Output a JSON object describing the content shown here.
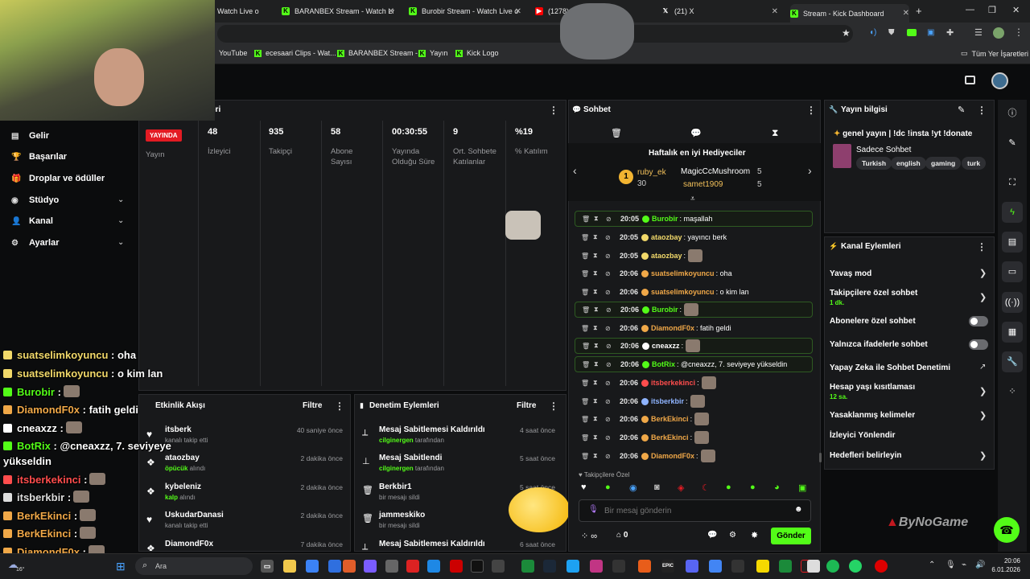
{
  "browser": {
    "tabs": [
      {
        "title": "Watch Live o"
      },
      {
        "title": "BARANBEX Stream - Watch Live"
      },
      {
        "title": "Burobir Stream - Watch Live o"
      },
      {
        "title": "(1278) Pon"
      },
      {
        "title": "(21) X"
      },
      {
        "title": "Stream - Kick Dashboard"
      }
    ],
    "new_tab": "+",
    "bookmarks": [
      "YouTube",
      "ecesaari Clips - Wat...",
      "BARANBEX Stream -...",
      "Yayın",
      "Kick Logo"
    ],
    "all_bookmarks": "Tüm Yer İşaretleri"
  },
  "nav": {
    "items": [
      {
        "label": "Gelir",
        "icon": "▤"
      },
      {
        "label": "Başarılar",
        "icon": "🏆"
      },
      {
        "label": "Droplar ve ödüller",
        "icon": "🎁"
      },
      {
        "label": "Stüdyo",
        "icon": "◉"
      },
      {
        "label": "Kanal",
        "icon": "👤"
      },
      {
        "label": "Ayarlar",
        "icon": "⚙"
      }
    ]
  },
  "stats": {
    "title_fragment": "eri",
    "live_badge": "YAYINDA",
    "live_label": "Yayın",
    "items": [
      {
        "value": "48",
        "label": "İzleyici"
      },
      {
        "value": "935",
        "label": "Takipçi"
      },
      {
        "value": "58",
        "label": "Abone Sayısı"
      },
      {
        "value": "00:30:55",
        "label": "Yayında Olduğu Süre"
      },
      {
        "value": "9",
        "label": "Ort. Sohbete Katılanlar"
      },
      {
        "value": "%19",
        "label": "% Katılım"
      }
    ]
  },
  "activity": {
    "title": "Etkinlik Akışı",
    "filter": "Filtre",
    "rows": [
      {
        "name": "itsberk",
        "detail": "kanalı takip etti",
        "time": "40 saniye önce",
        "icon": "♥"
      },
      {
        "name": "ataozbay",
        "detail_hl": "öpücük",
        "detail": " alındı",
        "time": "2 dakika önce",
        "icon": "❖"
      },
      {
        "name": "kybeleniz",
        "detail_hl": "kalp",
        "detail": " alındı",
        "time": "2 dakika önce",
        "icon": "❖"
      },
      {
        "name": "UskudarDanasi",
        "detail": "kanalı takip etti",
        "time": "2 dakika önce",
        "icon": "♥"
      },
      {
        "name": "DiamondF0x",
        "detail": "",
        "time": "7 dakika önce",
        "icon": "❖"
      }
    ]
  },
  "moderation": {
    "title": "Denetim Eylemleri",
    "filter": "Filtre",
    "rows": [
      {
        "name": "Mesaj Sabitlemesi Kaldırıldı",
        "by": "cilginergen",
        "detail": " tarafından",
        "time": "4 saat önce",
        "icon": "⟂"
      },
      {
        "name": "Mesaj Sabitlendi",
        "by": "cilginergen",
        "detail": " tarafından",
        "time": "5 saat önce",
        "icon": "⊥"
      },
      {
        "name": "Berkbir1",
        "by": "",
        "detail": "bir mesajı sildi",
        "time": "5 saat önce",
        "icon": "🗑"
      },
      {
        "name": "jammeskiko",
        "by": "",
        "detail": "bir mesajı sildi",
        "time": "",
        "icon": "🗑"
      },
      {
        "name": "Mesaj Sabitlemesi Kaldırıldı",
        "by": "",
        "detail": "",
        "time": "6 saat önce",
        "icon": "⟂"
      }
    ]
  },
  "chat": {
    "title": "Sohbet",
    "gifters_title": "Haftalık en iyi Hediyeciler",
    "gifters": [
      {
        "name": "ruby_ek",
        "count": "30",
        "rank": "1"
      },
      {
        "name": "MagicCcMushroom",
        "count": "5"
      },
      {
        "name": "samet1909",
        "count": "5"
      }
    ],
    "messages": [
      {
        "time": "20:05",
        "user": "Burobir",
        "text": ": maşallah",
        "color": "#53fc18",
        "hl": true,
        "emote": false
      },
      {
        "time": "20:05",
        "user": "ataozbay",
        "text": ": yayıncı berk",
        "color": "#f2d96a",
        "hl": false,
        "emote": false
      },
      {
        "time": "20:05",
        "user": "ataozbay",
        "text": ":",
        "color": "#f2d96a",
        "hl": false,
        "emote": true
      },
      {
        "time": "20:06",
        "user": "suatselimkoyuncu",
        "text": ": oha",
        "color": "#f0a848",
        "hl": false,
        "emote": false
      },
      {
        "time": "20:06",
        "user": "suatselimkoyuncu",
        "text": ": o kim lan",
        "color": "#f0a848",
        "hl": false,
        "emote": false
      },
      {
        "time": "20:06",
        "user": "Burobir",
        "text": ":",
        "color": "#53fc18",
        "hl": true,
        "emote": true
      },
      {
        "time": "20:06",
        "user": "DiamondF0x",
        "text": ": fatih geldi",
        "color": "#f0a848",
        "hl": false,
        "emote": false
      },
      {
        "time": "20:06",
        "user": "cneaxzz",
        "text": ":",
        "color": "#ffffff",
        "hl": true,
        "emote": true
      },
      {
        "time": "20:06",
        "user": "BotRix",
        "text": ": @cneaxzz, 7. seviyeye yükseldin",
        "color": "#53fc18",
        "hl": true,
        "emote": false
      },
      {
        "time": "20:06",
        "user": "itsberkekinci",
        "text": ":",
        "color": "#ff4d4d",
        "hl": false,
        "emote": true
      },
      {
        "time": "20:06",
        "user": "itsberkbir",
        "text": ":",
        "color": "#8fb4ff",
        "hl": false,
        "emote": true
      },
      {
        "time": "20:06",
        "user": "BerkEkinci",
        "text": ":",
        "color": "#f0a848",
        "hl": false,
        "emote": true
      },
      {
        "time": "20:06",
        "user": "BerkEkinci",
        "text": ":",
        "color": "#f0a848",
        "hl": false,
        "emote": true
      },
      {
        "time": "20:06",
        "user": "DiamondF0x",
        "text": ":",
        "color": "#f0a848",
        "hl": false,
        "emote": true
      }
    ],
    "followers_only": "Takipçilere Özel",
    "input_placeholder": "Bir mesaj gönderin",
    "infinity": "∞",
    "gift_count": "0",
    "send": "Gönder"
  },
  "stream_info": {
    "title": "Yayın bilgisi",
    "stream_title": "genel yayın | !dc !insta !yt !donate",
    "category": "Sadece Sohbet",
    "tags": [
      "Turkish",
      "english",
      "gaming",
      "turk"
    ]
  },
  "channel_actions": {
    "title": "Kanal Eylemleri",
    "rows": [
      {
        "label": "Yavaş mod",
        "sub": "",
        "control": "chevron"
      },
      {
        "label": "Takipçilere özel sohbet",
        "sub": "1 dk.",
        "control": "chevron"
      },
      {
        "label": "Abonelere özel sohbet",
        "sub": "",
        "control": "toggle"
      },
      {
        "label": "Yalnızca ifadelerle sohbet",
        "sub": "",
        "control": "toggle"
      },
      {
        "label": "Yapay Zeka ile Sohbet Denetimi",
        "sub": "",
        "control": "external"
      },
      {
        "label": "Hesap yaşı kısıtlaması",
        "sub": "12 sa.",
        "control": "chevron"
      },
      {
        "label": "Yasaklanmış kelimeler",
        "sub": "",
        "control": "chevron"
      },
      {
        "label": "İzleyici Yönlendir",
        "sub": "",
        "control": "none"
      },
      {
        "label": "Hedefleri belirleyin",
        "sub": "",
        "control": "chevron"
      }
    ]
  },
  "overlay_chat": [
    {
      "user": "suatselimkoyuncu",
      "text": " : oha",
      "color": "#f2d96a",
      "emote": false
    },
    {
      "user": "suatselimkoyuncu",
      "text": " : o kim lan",
      "color": "#f2d96a",
      "emote": false
    },
    {
      "user": "Burobir",
      "text": " :",
      "color": "#53fc18",
      "emote": true
    },
    {
      "user": "DiamondF0x",
      "text": " : fatih geldi",
      "color": "#f0a848",
      "emote": false
    },
    {
      "user": "cneaxzz",
      "text": " :",
      "color": "#ffffff",
      "emote": true
    },
    {
      "user": "BotRix",
      "text": " : @cneaxzz, 7. seviyeye",
      "color": "#53fc18",
      "emote": false
    },
    {
      "user": "",
      "text": "yükseldin",
      "color": "#ffffff",
      "emote": false
    },
    {
      "user": "itsberkekinci",
      "text": " :",
      "color": "#ff4d4d",
      "emote": true
    },
    {
      "user": "itsberkbir",
      "text": " :",
      "color": "#dddddd",
      "emote": true
    },
    {
      "user": "BerkEkinci",
      "text": " :",
      "color": "#f0a848",
      "emote": true
    },
    {
      "user": "BerkEkinci",
      "text": " :",
      "color": "#f0a848",
      "emote": true
    },
    {
      "user": "DiamondF0x",
      "text": " :",
      "color": "#f0a848",
      "emote": true
    }
  ],
  "watermark": "ByNoGame",
  "taskbar": {
    "search": "Ara",
    "weather": "16°",
    "time": "20:06",
    "date": "6.01.2026"
  },
  "colors": {
    "accent": "#53fc18",
    "live": "#e31b23",
    "panel": "#18191b"
  }
}
